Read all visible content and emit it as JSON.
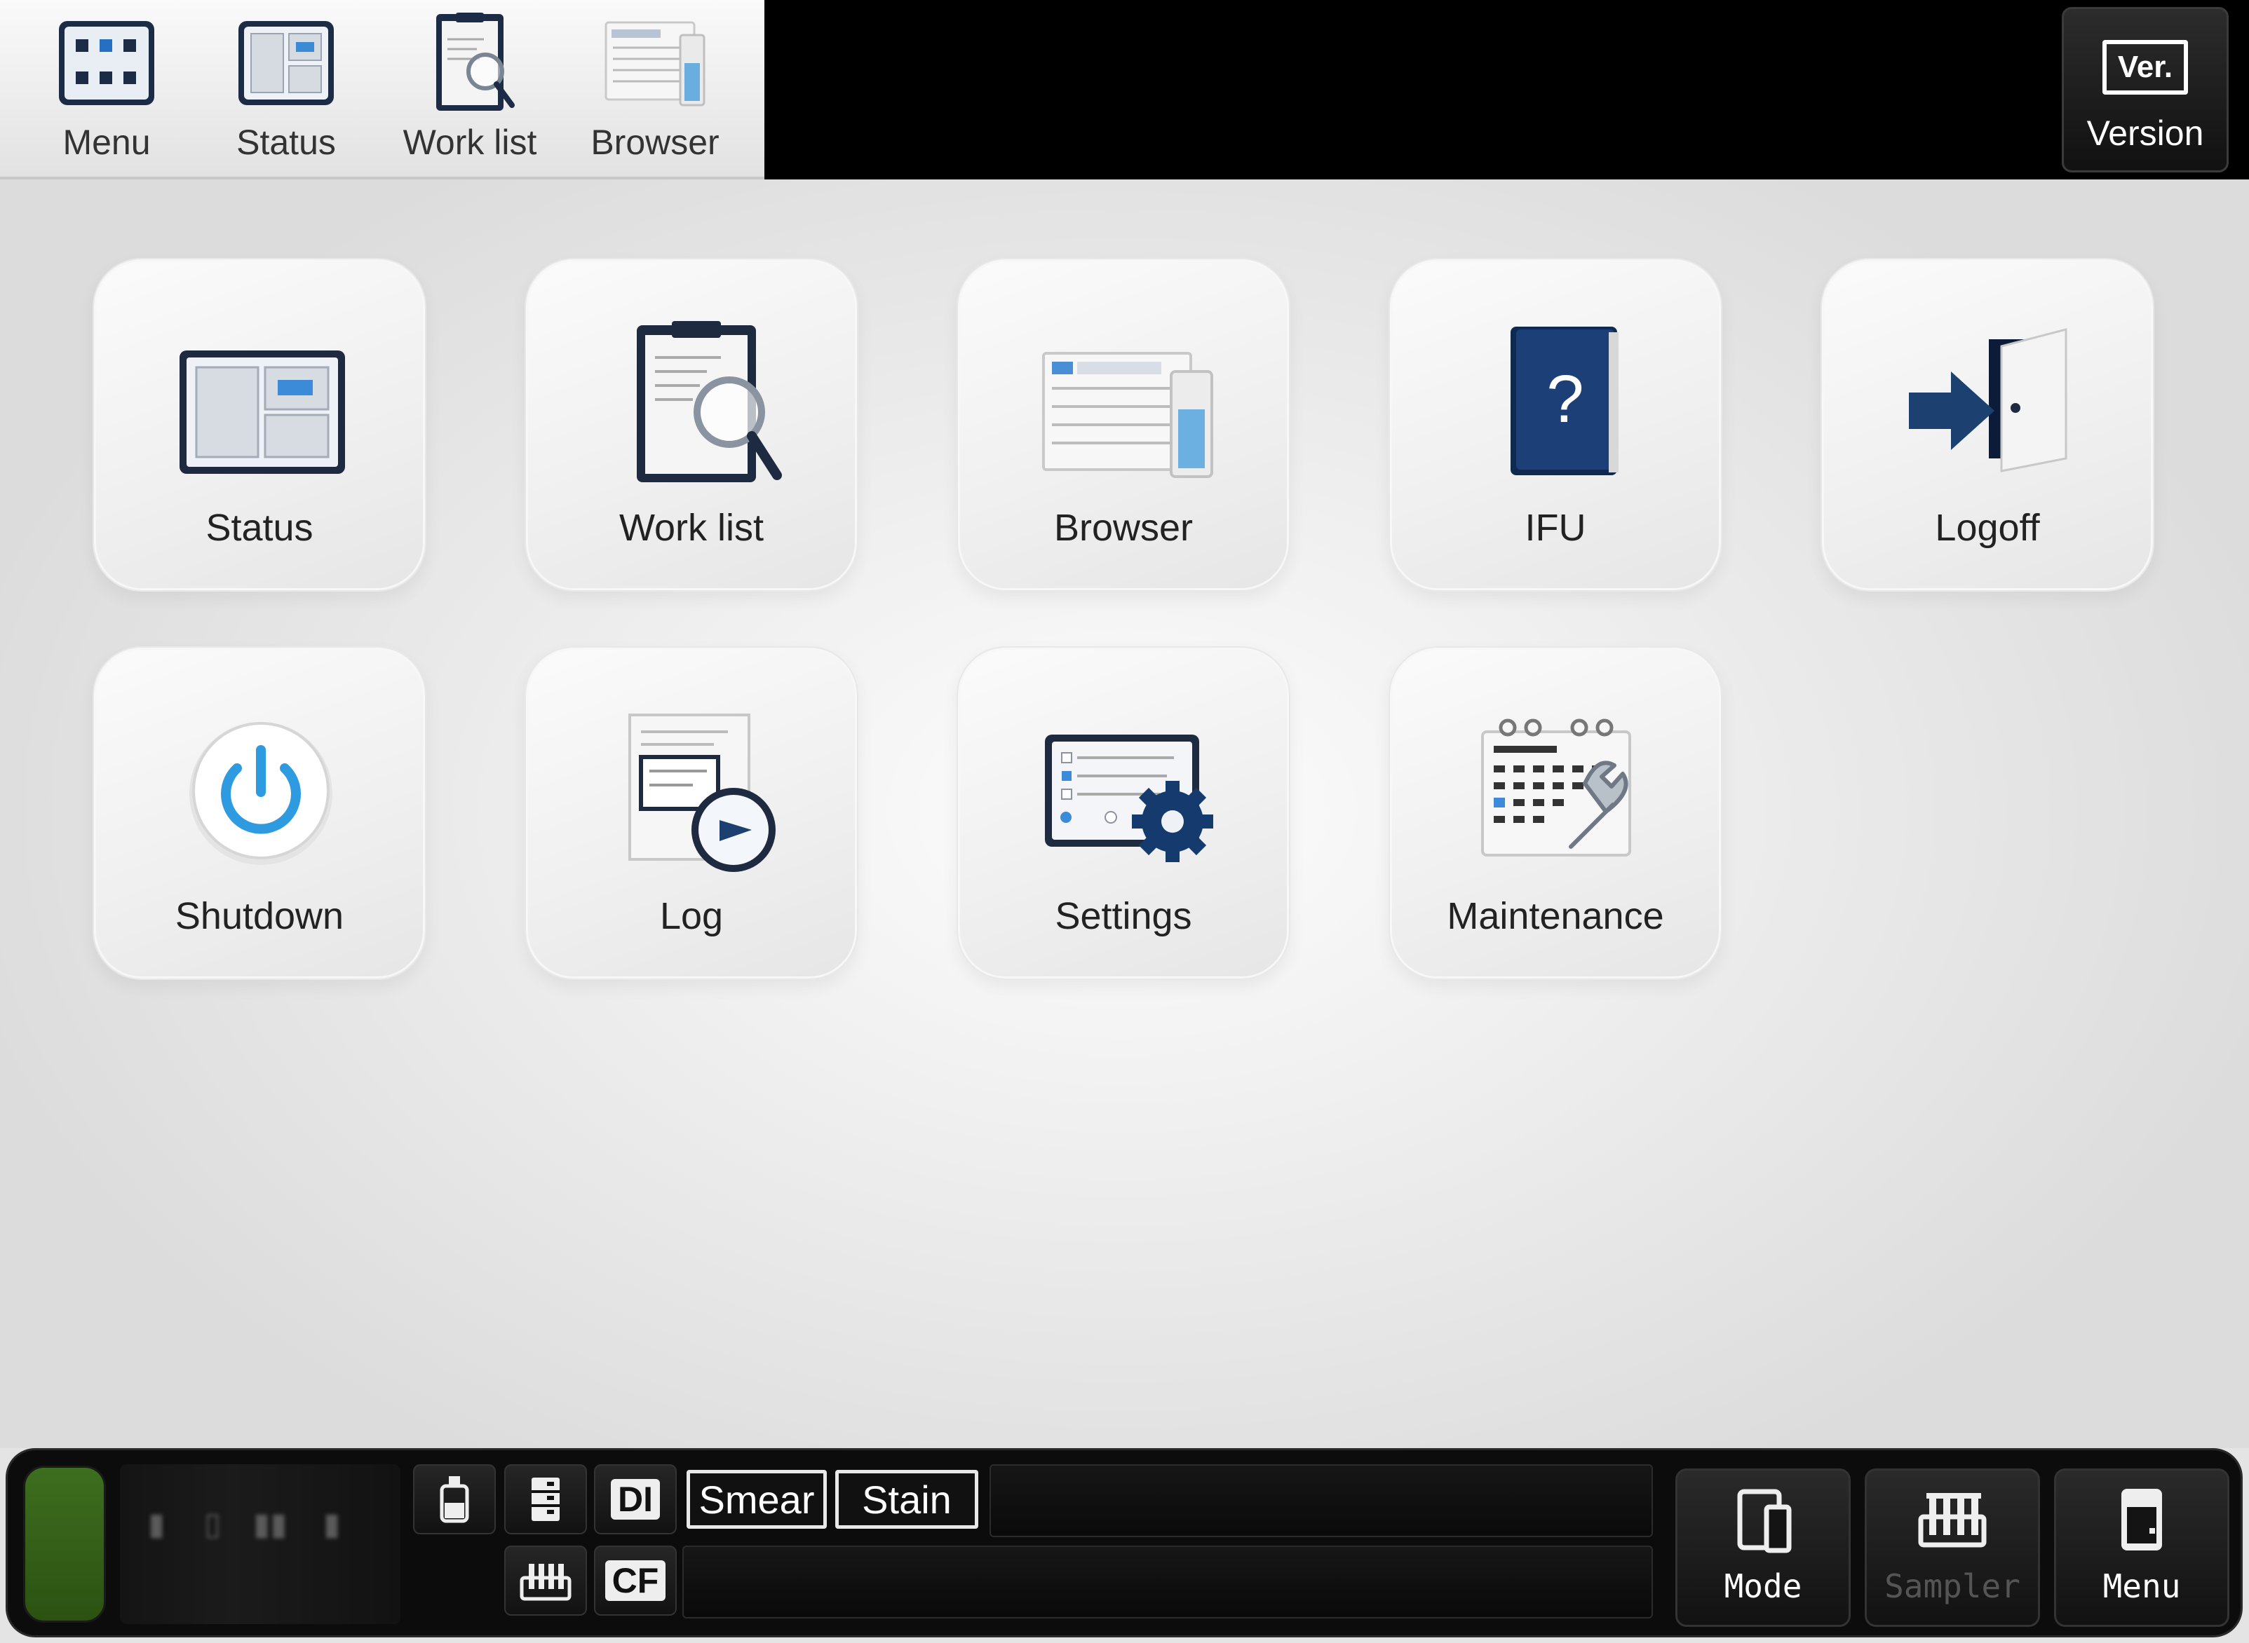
{
  "top_nav": {
    "tabs": [
      {
        "label": "Menu",
        "icon": "menu-grid-icon"
      },
      {
        "label": "Status",
        "icon": "status-panel-icon"
      },
      {
        "label": "Work list",
        "icon": "worklist-clipboard-icon"
      },
      {
        "label": "Browser",
        "icon": "browser-icon"
      }
    ],
    "version_badge": "Ver.",
    "version_label": "Version"
  },
  "main_menu": {
    "tiles": [
      {
        "label": "Status",
        "icon": "status-panel-icon"
      },
      {
        "label": "Work list",
        "icon": "worklist-clipboard-icon"
      },
      {
        "label": "Browser",
        "icon": "browser-icon"
      },
      {
        "label": "IFU",
        "icon": "help-book-icon"
      },
      {
        "label": "Logoff",
        "icon": "logoff-door-icon"
      },
      {
        "label": "Shutdown",
        "icon": "power-icon"
      },
      {
        "label": "Log",
        "icon": "log-clock-icon"
      },
      {
        "label": "Settings",
        "icon": "settings-gear-icon"
      },
      {
        "label": "Maintenance",
        "icon": "maintenance-calendar-icon"
      }
    ]
  },
  "status_bar": {
    "indicator_color": "#3d6e1e",
    "tags": {
      "di": "DI",
      "cf": "CF",
      "smear": "Smear",
      "stain": "Stain"
    },
    "buttons": [
      {
        "label": "Mode",
        "enabled": true
      },
      {
        "label": "Sampler",
        "enabled": false
      },
      {
        "label": "Menu",
        "enabled": true
      }
    ]
  },
  "colors": {
    "accent_navy": "#1c3a68",
    "power_blue": "#2e9be0",
    "topbar_black": "#000000"
  }
}
